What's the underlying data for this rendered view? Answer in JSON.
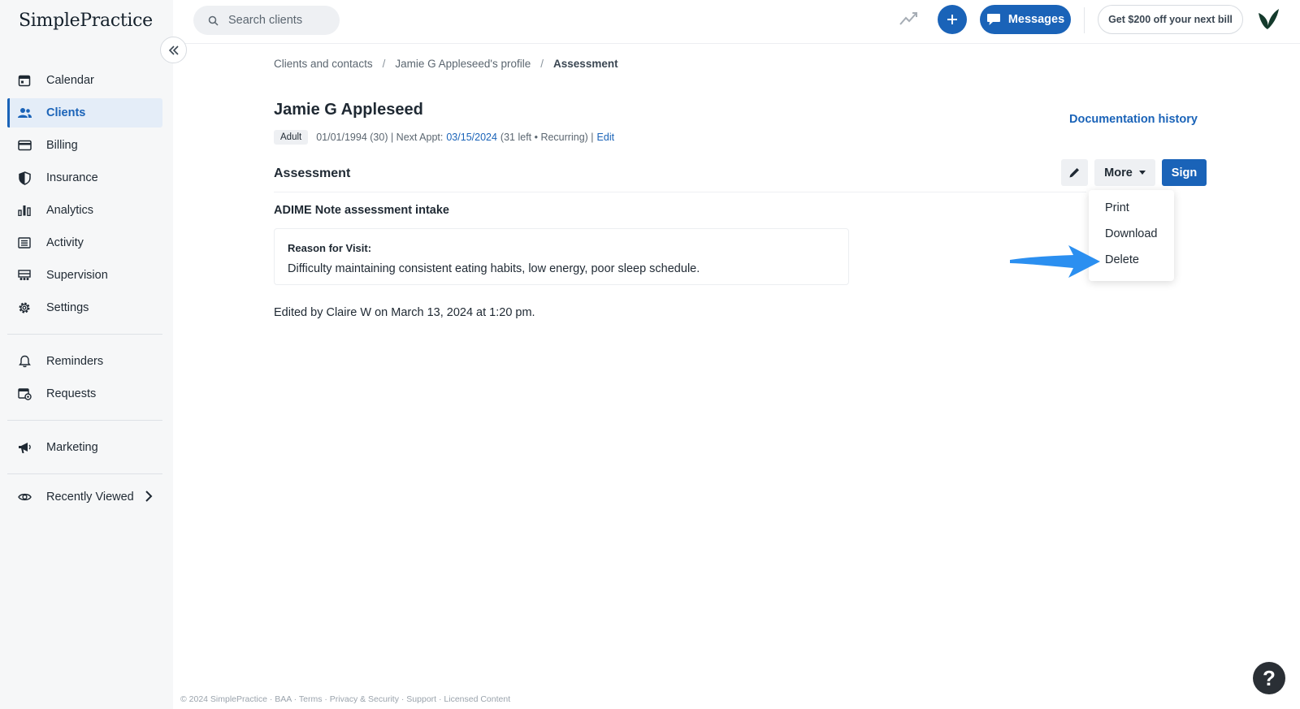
{
  "app": {
    "logo_text": "SimplePractice"
  },
  "sidebar": {
    "items": [
      {
        "label": "Calendar",
        "icon": "calendar-icon"
      },
      {
        "label": "Clients",
        "icon": "users-icon",
        "active": true
      },
      {
        "label": "Billing",
        "icon": "credit-card-icon"
      },
      {
        "label": "Insurance",
        "icon": "shield-icon"
      },
      {
        "label": "Analytics",
        "icon": "bar-chart-icon"
      },
      {
        "label": "Activity",
        "icon": "list-icon"
      },
      {
        "label": "Supervision",
        "icon": "supervision-icon"
      },
      {
        "label": "Settings",
        "icon": "gear-icon"
      },
      {
        "label": "Reminders",
        "icon": "bell-icon"
      },
      {
        "label": "Requests",
        "icon": "calendar-request-icon"
      },
      {
        "label": "Marketing",
        "icon": "megaphone-icon"
      },
      {
        "label": "Recently Viewed",
        "icon": "eye-icon"
      }
    ]
  },
  "topbar": {
    "search_placeholder": "Search clients",
    "messages_label": "Messages",
    "promo_label": "Get $200 off your next bill"
  },
  "breadcrumb": {
    "items": [
      "Clients and contacts",
      "Jamie G Appleseed's profile",
      "Assessment"
    ],
    "separator": "/"
  },
  "client": {
    "name": "Jamie G Appleseed",
    "badge": "Adult",
    "dob_text": "01/01/1994 (30) | Next Appt:",
    "next_appt": "03/15/2024",
    "appt_detail": "(31 left • Recurring) |",
    "edit_link": "Edit"
  },
  "documentation_history_label": "Documentation history",
  "assessment": {
    "section_title": "Assessment",
    "more_label": "More",
    "sign_label": "Sign",
    "dropdown": [
      "Print",
      "Download",
      "Delete"
    ],
    "note_title": "ADIME Note assessment intake",
    "reason_label": "Reason for Visit:",
    "reason_value": "Difficulty maintaining consistent eating habits, low energy, poor sleep schedule.",
    "edited_text": "Edited by Claire W on March 13, 2024 at 1:20 pm."
  },
  "footer": {
    "text": "© 2024 SimplePractice · BAA · Terms · Privacy & Security · Support · Licensed Content"
  },
  "help_label": "?",
  "colors": {
    "primary": "#1a63b8",
    "annotation_arrow": "#2b8ff0",
    "sidebar_bg": "#f6f7f8"
  }
}
